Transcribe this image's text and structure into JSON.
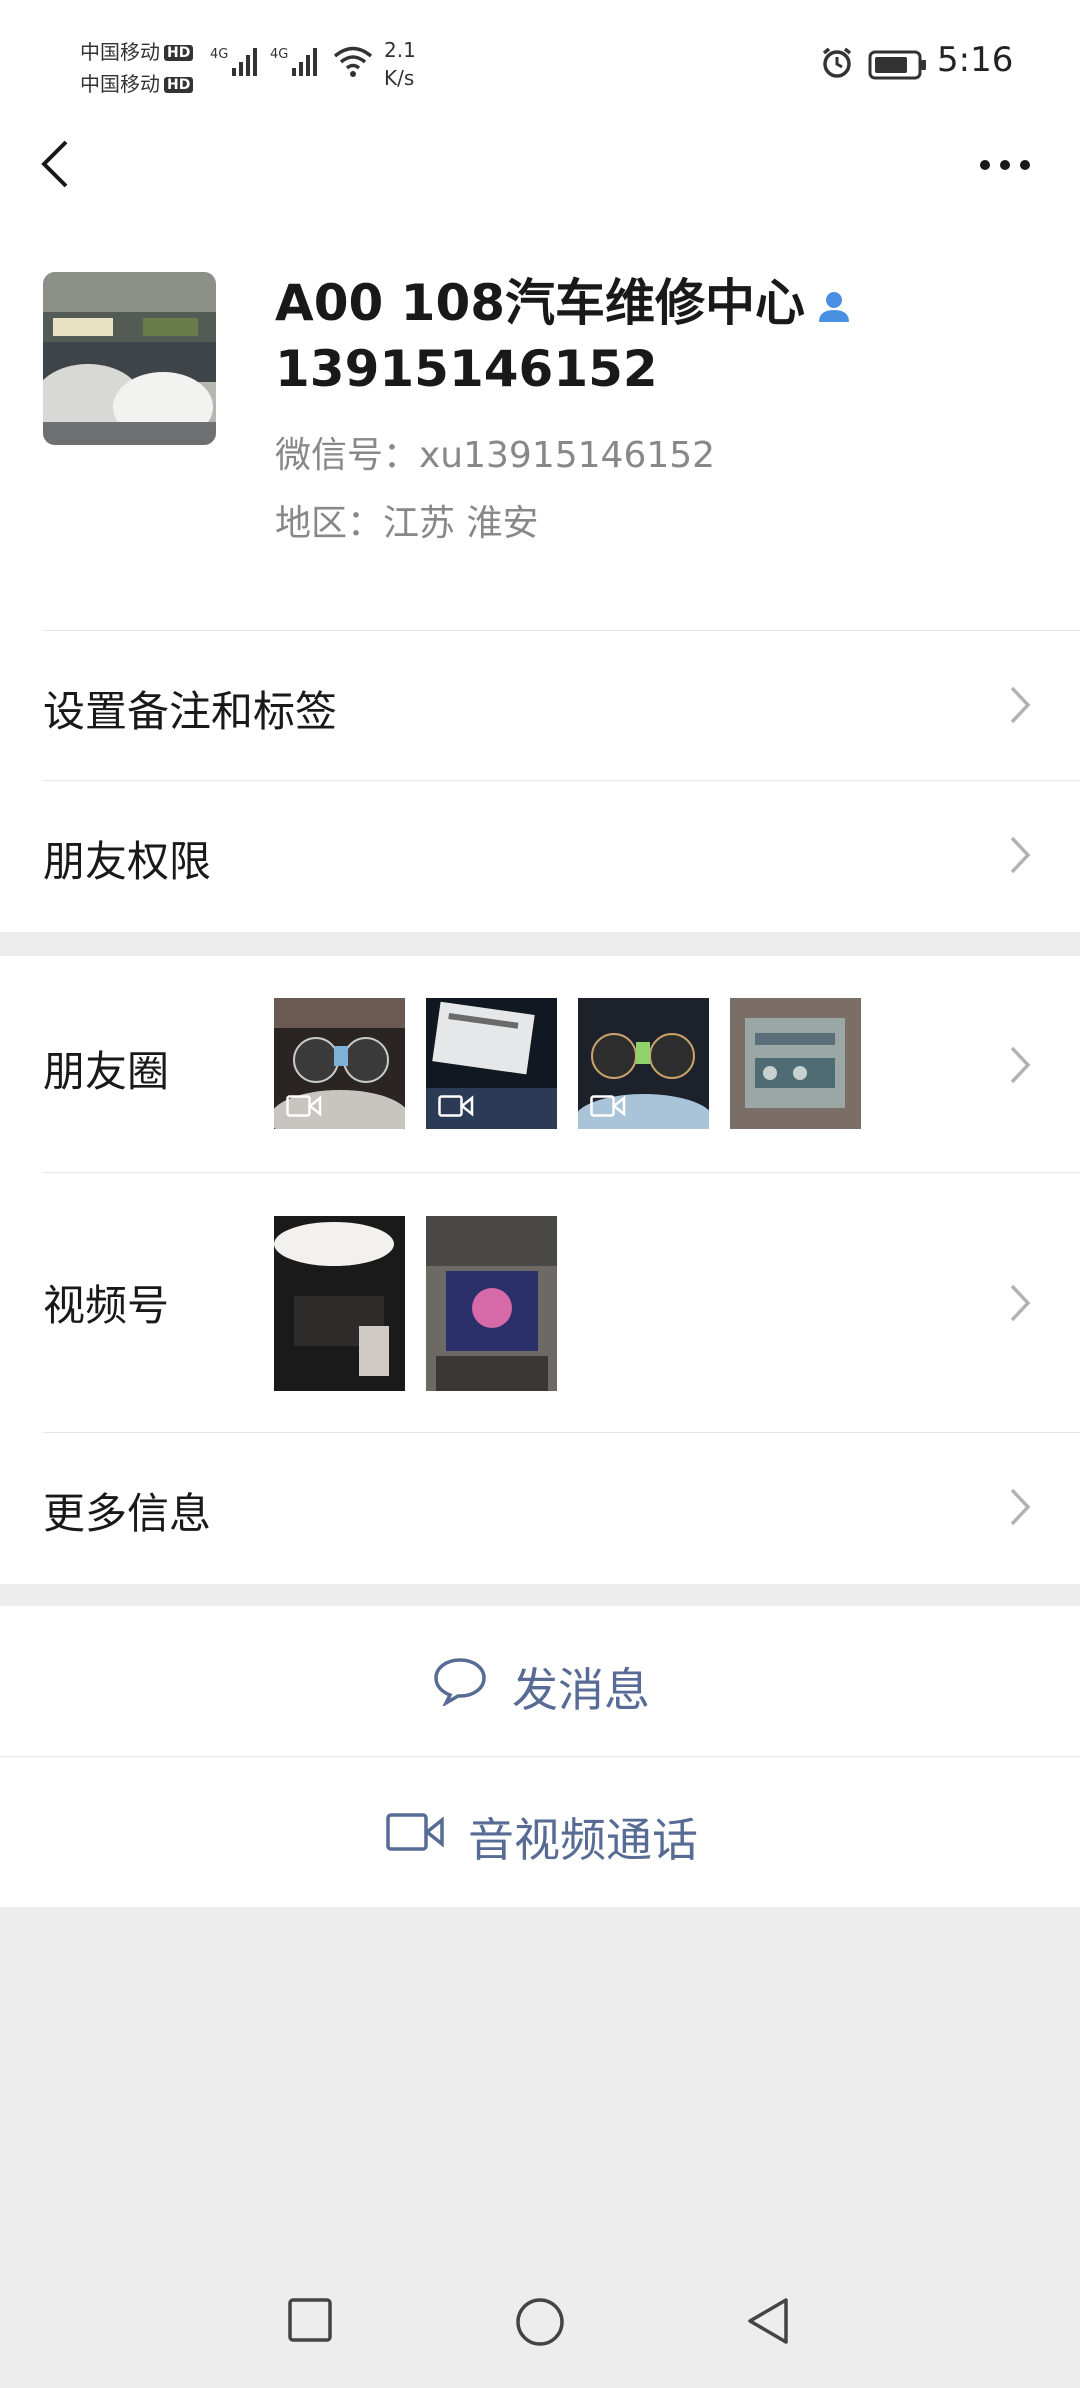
{
  "status_bar": {
    "carrier1": "中国移动",
    "carrier2": "中国移动",
    "hd_badge": "HD",
    "signal1_type": "4G",
    "signal2_type": "4G",
    "net_speed_value": "2.1",
    "net_speed_unit": "K/s",
    "time": "5:16"
  },
  "nav": {
    "back_icon": "chevron-left-icon",
    "more_icon": "more-horizontal-icon"
  },
  "profile": {
    "name_line1": "A00 108汽车维修中心",
    "name_line2": "13915146152",
    "wechat_id": "微信号：xu13915146152",
    "region": "地区：江苏  淮安"
  },
  "rows": {
    "remark": "设置备注和标签",
    "permission": "朋友权限",
    "moments": "朋友圈",
    "channels": "视频号",
    "more_info": "更多信息"
  },
  "actions": {
    "message": "发消息",
    "call": "音视频通话"
  },
  "colors": {
    "link_blue": "#576b95",
    "background": "#ededed",
    "card": "#ffffff",
    "contact_icon": "#4a90e2"
  }
}
